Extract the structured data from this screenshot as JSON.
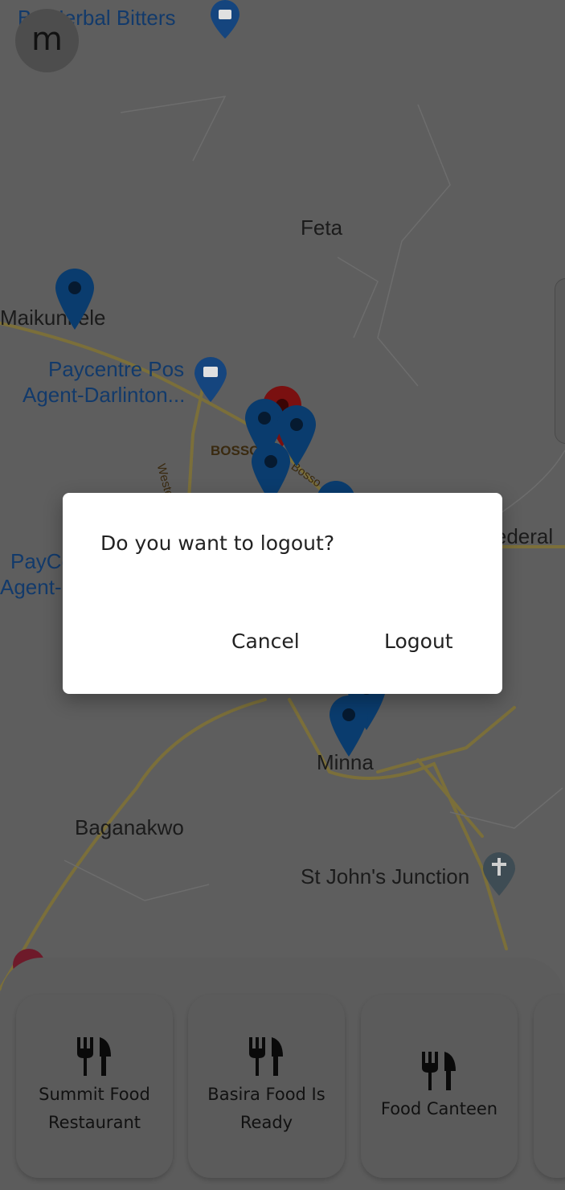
{
  "avatar": {
    "initial": "m"
  },
  "map": {
    "places": [
      "Feta",
      "Maikunkele",
      "Minna",
      "Baganakwo",
      "St John's Junction",
      "Federal"
    ],
    "pois": [
      "Bo Herbal Bitters",
      "Paycentre Pos",
      "Agent-Darlinton...",
      "PayCentre Pos",
      "Agent-"
    ],
    "roads": [
      "BOSSO",
      "Western Bypass",
      "Bosso"
    ]
  },
  "dialog": {
    "message": "Do you want to logout?",
    "cancel_label": "Cancel",
    "logout_label": "Logout"
  },
  "restaurants": [
    {
      "name_line1": "Summit Food",
      "name_line2": "Restaurant",
      "icon": "utensils-icon"
    },
    {
      "name_line1": "Basira Food Is",
      "name_line2": "Ready",
      "icon": "utensils-icon"
    },
    {
      "name_line1": "Food Canteen",
      "name_line2": "",
      "icon": "utensils-icon"
    }
  ],
  "colors": {
    "pin_blue": "#0a3c6e",
    "pin_red": "#7a1010",
    "map_road": "#8a7a3c",
    "scrim_base": "#5e5e5e"
  }
}
